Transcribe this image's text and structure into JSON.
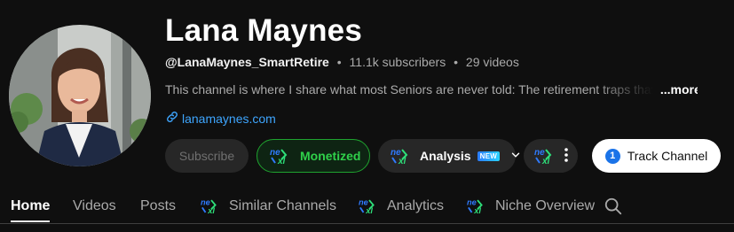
{
  "channel": {
    "name": "Lana Maynes",
    "handle": "@LanaMaynes_SmartRetire",
    "separator": "•",
    "subscribers": "11.1k subscribers",
    "videos": "29 videos",
    "description": "This channel is where I share what most Seniors are never told: The retirement traps that",
    "more_label": "...more",
    "link": "lanamaynes.com"
  },
  "buttons": {
    "subscribe": "Subscribe",
    "monetized": "Monetized",
    "analysis": "Analysis",
    "new_badge": "NEW",
    "track_badge": "1",
    "track": "Track Channel"
  },
  "tabs": [
    {
      "label": "Home",
      "active": true
    },
    {
      "label": "Videos"
    },
    {
      "label": "Posts"
    },
    {
      "label": "Similar Channels",
      "icon": "nexlev-logo"
    },
    {
      "label": "Analytics",
      "icon": "nexlev-logo"
    },
    {
      "label": "Niche Overview",
      "icon": "nexlev-logo"
    }
  ],
  "colors": {
    "background": "#0f0f0f",
    "link": "#3ea6ff",
    "monetized_green": "#2fd04a",
    "nexlev_blue": "#2f7bff",
    "nexlev_green": "#2ee07a"
  },
  "icons": {
    "link": "link-icon",
    "chevron": "chevron-down-icon",
    "kebab": "vertical-ellipsis-icon",
    "search": "search-icon",
    "brand": "nexlev-logo"
  }
}
